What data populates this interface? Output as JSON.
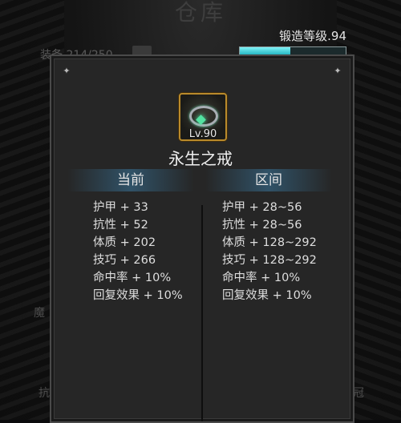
{
  "background": {
    "title": "仓库",
    "capacity": "装备 214/250",
    "side_texts": [
      "魔",
      "抗",
      "冠"
    ]
  },
  "forge": {
    "label": "锻造等级.94",
    "progress": 0.48,
    "bar_color": "#3fd3de"
  },
  "item": {
    "icon": "ring-icon",
    "level": "Lv.90",
    "name": "永生之戒",
    "border_color": "#b98a2b"
  },
  "columns": {
    "current": "当前",
    "range": "区间"
  },
  "current_stats": [
    "护甲 + 33",
    "抗性 + 52",
    "体质 + 202",
    "技巧 + 266",
    "命中率 + 10%",
    "回复效果 + 10%"
  ],
  "range_stats": [
    "护甲 + 28~56",
    "抗性 + 28~56",
    "体质 + 128~292",
    "技巧 + 128~292",
    "命中率 + 10%",
    "回复效果 + 10%"
  ]
}
